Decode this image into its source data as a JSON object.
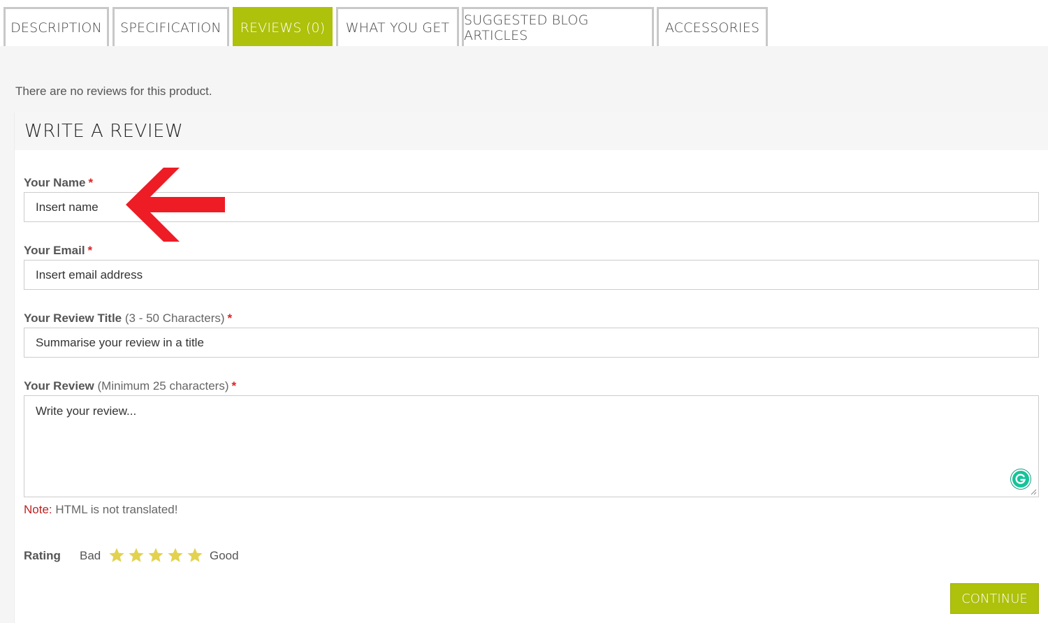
{
  "tabs": [
    {
      "label": "DESCRIPTION",
      "active": false
    },
    {
      "label": "SPECIFICATION",
      "active": false
    },
    {
      "label": "REVIEWS (0)",
      "active": true
    },
    {
      "label": "WHAT YOU GET",
      "active": false
    },
    {
      "label": "SUGGESTED BLOG ARTICLES",
      "active": false
    },
    {
      "label": "ACCESSORIES",
      "active": false
    }
  ],
  "reviews": {
    "empty_message": "There are no reviews for this product."
  },
  "form": {
    "title": "WRITE A REVIEW",
    "required_marker": "*",
    "name": {
      "label": "Your Name",
      "placeholder": "Insert name"
    },
    "email": {
      "label": "Your Email",
      "placeholder": "Insert email address"
    },
    "review_title": {
      "label": "Your Review Title",
      "hint": "(3 - 50 Characters)",
      "placeholder": "Summarise your review in a title"
    },
    "review": {
      "label": "Your Review",
      "hint": "(Minimum 25 characters)",
      "placeholder": "Write your review..."
    },
    "note": {
      "key": "Note:",
      "text": "HTML is not translated!"
    },
    "rating": {
      "label": "Rating",
      "low": "Bad",
      "high": "Good",
      "stars": 5
    },
    "submit_label": "CONTINUE"
  },
  "colors": {
    "accent": "#aec10b",
    "arrow": "#ee1c25",
    "required": "#dd2222",
    "star": "#e3d24f",
    "grammarly": "#15c39a"
  },
  "icons": [
    "red-arrow-annotation-icon",
    "star-icon",
    "grammarly-icon",
    "resize-grip-icon"
  ]
}
